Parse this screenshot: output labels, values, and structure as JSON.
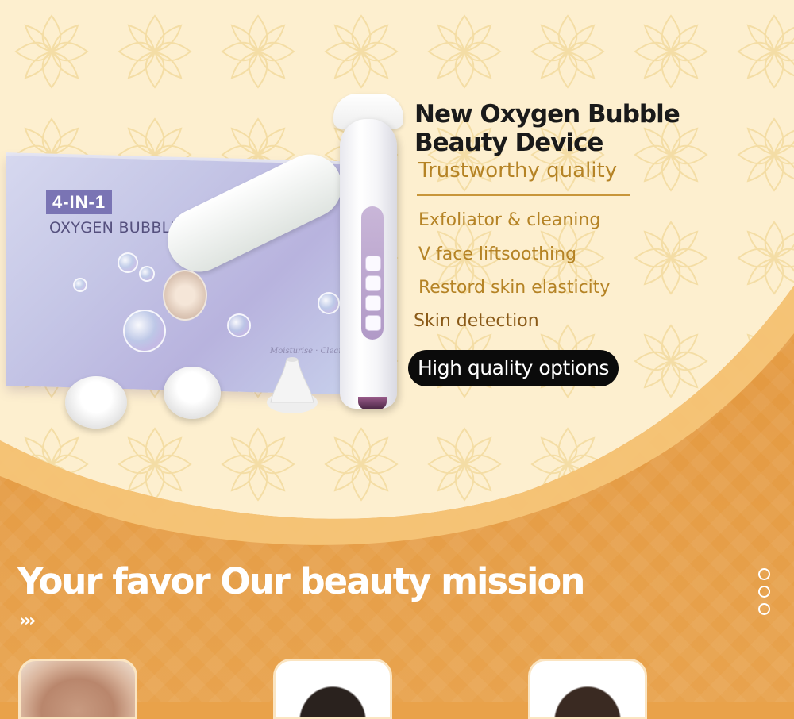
{
  "product_box": {
    "tag": "4-IN-1",
    "title": "OXYGEN BUBBLE METER",
    "small_text": "Moisturise · Cleanse"
  },
  "hero": {
    "title": "New Oxygen Bubble Beauty Device",
    "subtitle": "Trustworthy quality",
    "features": [
      "Exfoliator & cleaning",
      "V face liftsoothing",
      "Restord skin elasticity",
      "Skin detection"
    ],
    "highlight": "High quality options"
  },
  "mission": {
    "title": "Your favor Our beauty mission",
    "chevrons": "›››"
  },
  "pager": {
    "count": 3
  },
  "colors": {
    "gold_text": "#b58325",
    "cream": "#fdf0d0",
    "orange": "#e9a24a",
    "box_purple": "#7a74b4"
  },
  "icons": [
    "chevron-right-icon",
    "pager-dot-icon"
  ]
}
